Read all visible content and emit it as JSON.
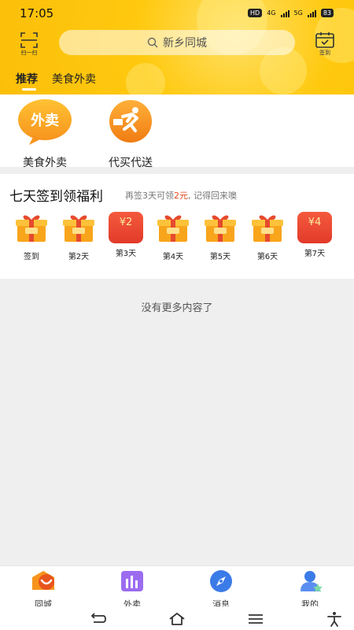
{
  "status_bar": {
    "time": "17:05",
    "hd_label": "HD",
    "net_4g": "4G",
    "net_5g": "5G",
    "battery": "83"
  },
  "header": {
    "scan_label": "扫一扫",
    "search_placeholder": "新乡同城",
    "checkin_label": "签到",
    "tabs": [
      {
        "label": "推荐",
        "active": true
      },
      {
        "label": "美食外卖",
        "active": false
      }
    ]
  },
  "quick_entries": [
    {
      "label": "美食外卖",
      "badge_text": "外卖",
      "icon": "takeout-bubble-icon"
    },
    {
      "label": "代买代送",
      "icon": "runner-icon"
    }
  ],
  "checkin": {
    "title": "七天签到领福利",
    "hint_prefix": "再签3天可领",
    "hint_highlight": "2元",
    "hint_suffix": ", 记得回来噢",
    "days": [
      {
        "label": "签到",
        "reward": "gift"
      },
      {
        "label": "第2天",
        "reward": "gift"
      },
      {
        "label": "第3天",
        "reward": "red-envelope",
        "amount": "¥2"
      },
      {
        "label": "第4天",
        "reward": "gift"
      },
      {
        "label": "第5天",
        "reward": "gift"
      },
      {
        "label": "第6天",
        "reward": "gift"
      },
      {
        "label": "第7天",
        "reward": "red-envelope",
        "amount": "¥4"
      }
    ]
  },
  "empty_text": "没有更多内容了",
  "bottom_nav": [
    {
      "label": "同城",
      "icon": "city-icon"
    },
    {
      "label": "外卖",
      "icon": "takeout-icon"
    },
    {
      "label": "消息",
      "icon": "compass-icon"
    },
    {
      "label": "我的",
      "icon": "profile-icon"
    }
  ],
  "colors": {
    "header_yellow": "#fbbf0a",
    "accent_orange": "#f7941d",
    "highlight_red": "#e4481c"
  }
}
